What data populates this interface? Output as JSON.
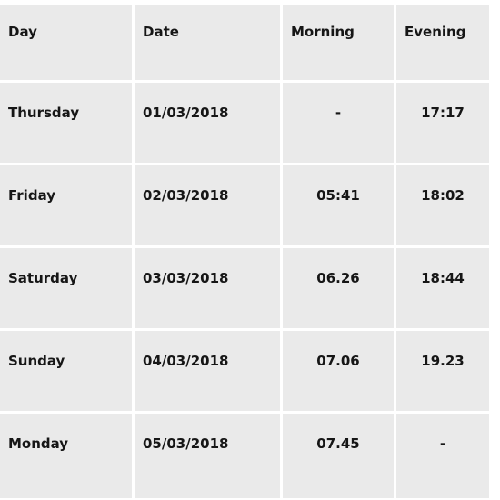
{
  "table": {
    "columns": [
      {
        "key": "day",
        "label": "Day",
        "align": "left"
      },
      {
        "key": "date",
        "label": "Date",
        "align": "left"
      },
      {
        "key": "morning",
        "label": "Morning",
        "align": "center"
      },
      {
        "key": "evening",
        "label": "Evening",
        "align": "center"
      }
    ],
    "rows": [
      {
        "day": "Thursday",
        "date": "01/03/2018",
        "morning": "-",
        "evening": "17:17"
      },
      {
        "day": "Friday",
        "date": "02/03/2018",
        "morning": "05:41",
        "evening": "18:02"
      },
      {
        "day": "Saturday",
        "date": "03/03/2018",
        "morning": "06.26",
        "evening": "18:44"
      },
      {
        "day": "Sunday",
        "date": "04/03/2018",
        "morning": "07.06",
        "evening": "19.23"
      },
      {
        "day": "Monday",
        "date": "05/03/2018",
        "morning": "07.45",
        "evening": "-"
      }
    ]
  },
  "colors": {
    "cell_background": "#eaeaea",
    "page_background": "#ffffff",
    "grid_line": "#ffffff",
    "text": "#161616"
  }
}
